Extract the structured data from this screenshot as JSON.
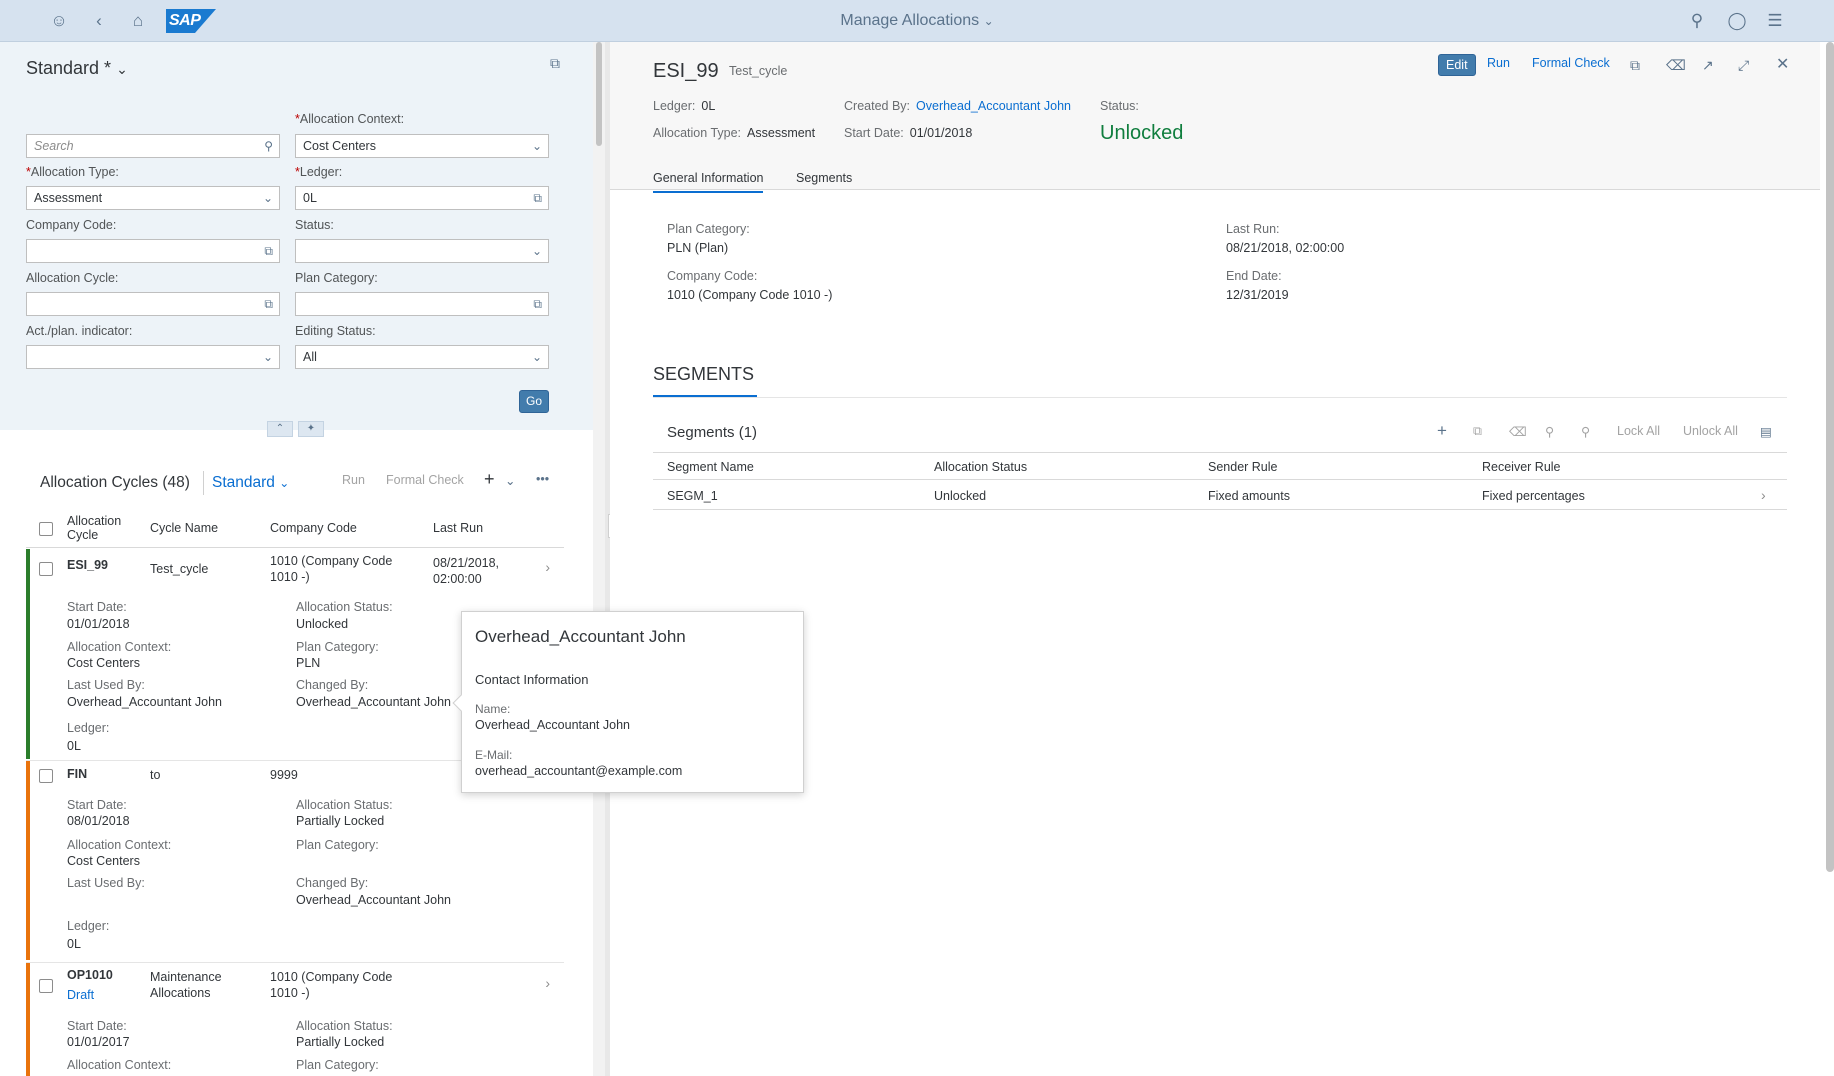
{
  "shell": {
    "logo": "SAP",
    "title": "Manage Allocations",
    "icons": [
      "user-icon",
      "back-icon",
      "home-icon",
      "search-icon",
      "help-icon",
      "notifications-icon"
    ]
  },
  "filter": {
    "variant": "Standard *",
    "search_placeholder": "Search",
    "allocation_context_label": "Allocation Context:",
    "allocation_context_value": "Cost Centers",
    "allocation_type_label": "Allocation Type:",
    "allocation_type_value": "Assessment",
    "ledger_label": "Ledger:",
    "ledger_value": "0L",
    "company_code_label": "Company Code:",
    "company_code_value": "",
    "status_label": "Status:",
    "status_value": "",
    "allocation_cycle_label": "Allocation Cycle:",
    "allocation_cycle_value": "",
    "plan_category_label": "Plan Category:",
    "plan_category_value": "",
    "actplan_label": "Act./plan. indicator:",
    "actplan_value": "",
    "editing_status_label": "Editing Status:",
    "editing_status_value": "All",
    "go_label": "Go"
  },
  "table": {
    "title": "Allocation Cycles (48)",
    "variant": "Standard",
    "run_label": "Run",
    "formal_check_label": "Formal Check",
    "more_label": "•••",
    "col_cycle": "Allocation Cycle",
    "col_name": "Cycle Name",
    "col_company": "Company Code",
    "col_lastrun": "Last Run",
    "rows": [
      {
        "cycle": "ESI_99",
        "name": "Test_cycle",
        "company": "1010 (Company Code 1010 -)",
        "last_run": "08/21/2018, 02:00:00",
        "start_date_label": "Start Date:",
        "start_date": "01/01/2018",
        "alloc_status_label": "Allocation Status:",
        "alloc_status": "Unlocked",
        "context_label": "Allocation Context:",
        "context": "Cost Centers",
        "plan_cat_label": "Plan Category:",
        "plan_cat": "PLN",
        "last_used_label": "Last Used By:",
        "last_used": "Overhead_Accountant John",
        "changed_label": "Changed By:",
        "changed": "Overhead_Accountant John",
        "ledger_label": "Ledger:",
        "ledger": "0L",
        "edge_color": "#2b7d2b"
      },
      {
        "cycle": "FIN",
        "name": "to",
        "company": "9999",
        "last_run": "",
        "start_date_label": "Start Date:",
        "start_date": "08/01/2018",
        "alloc_status_label": "Allocation Status:",
        "alloc_status": "Partially Locked",
        "context_label": "Allocation Context:",
        "context": "Cost Centers",
        "plan_cat_label": "Plan Category:",
        "plan_cat": "",
        "last_used_label": "Last Used By:",
        "last_used": "",
        "changed_label": "Changed By:",
        "changed": "Overhead_Accountant John",
        "ledger_label": "Ledger:",
        "ledger": "0L",
        "edge_color": "#e9730c"
      },
      {
        "cycle": "OP1010",
        "draft": "Draft",
        "name": "Maintenance Allocations",
        "company": "1010 (Company Code 1010 -)",
        "last_run": "",
        "start_date_label": "Start Date:",
        "start_date": "01/01/2017",
        "alloc_status_label": "Allocation Status:",
        "alloc_status": "Partially Locked",
        "context_label": "Allocation Context:",
        "plan_cat_label": "Plan Category:",
        "edge_color": "#e9730c"
      }
    ]
  },
  "detail": {
    "title": "ESI_99",
    "subtitle": "Test_cycle",
    "edit_label": "Edit",
    "run_label": "Run",
    "formal_check_label": "Formal Check",
    "ledger_label": "Ledger:",
    "ledger": "0L",
    "created_by_label": "Created By:",
    "created_by": "Overhead_Accountant John",
    "status_label": "Status:",
    "status": "Unlocked",
    "alloc_type_label": "Allocation Type:",
    "alloc_type": "Assessment",
    "start_date_label": "Start Date:",
    "start_date": "01/01/2018",
    "tabs": [
      "General Information",
      "Segments"
    ],
    "plan_category_label": "Plan Category:",
    "plan_category": "PLN (Plan)",
    "company_code_label": "Company Code:",
    "company_code": "1010 (Company Code 1010 -)",
    "last_run_label": "Last Run:",
    "last_run": "08/21/2018, 02:00:00",
    "end_date_label": "End Date:",
    "end_date": "12/31/2019",
    "segments_section": "SEGMENTS",
    "segments_table_title": "Segments (1)",
    "lock_all": "Lock All",
    "unlock_all": "Unlock All",
    "seg_cols": [
      "Segment Name",
      "Allocation Status",
      "Sender Rule",
      "Receiver Rule"
    ],
    "seg_rows": [
      {
        "name": "SEGM_1",
        "status": "Unlocked",
        "sender": "Fixed amounts",
        "receiver": "Fixed percentages"
      }
    ]
  },
  "popover": {
    "title": "Overhead_Accountant John",
    "section": "Contact Information",
    "name_label": "Name:",
    "name": "Overhead_Accountant John",
    "email_label": "E-Mail:",
    "email": "overhead_accountant@example.com"
  }
}
